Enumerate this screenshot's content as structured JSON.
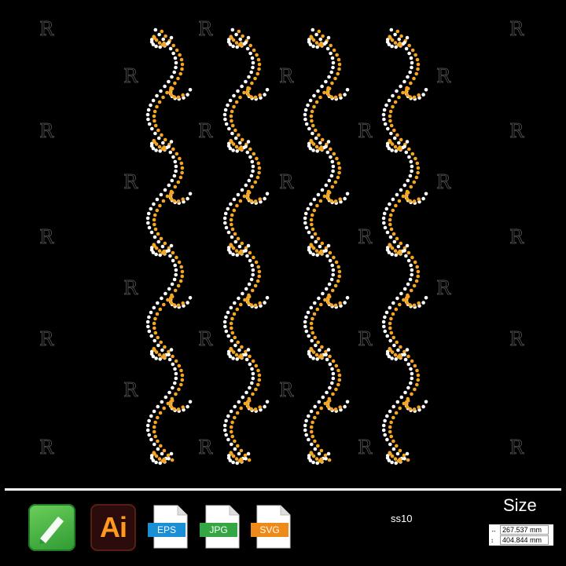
{
  "design": {
    "columns": 4,
    "colors": {
      "background": "#000000",
      "gold": "#f3a524",
      "white": "#ffffff"
    },
    "watermark_icon": "rs-logo-watermark"
  },
  "footer": {
    "apps": [
      {
        "name": "coreldraw-icon"
      },
      {
        "name": "illustrator-icon",
        "label": "Ai"
      }
    ],
    "file_types": [
      {
        "label": "EPS",
        "color": "#1b8fd6"
      },
      {
        "label": "JPG",
        "color": "#34a744"
      },
      {
        "label": "SVG",
        "color": "#ee8a17"
      }
    ],
    "stone_size": "ss10",
    "size_title": "Size",
    "width": "267.537 mm",
    "height": "404.844 mm"
  }
}
